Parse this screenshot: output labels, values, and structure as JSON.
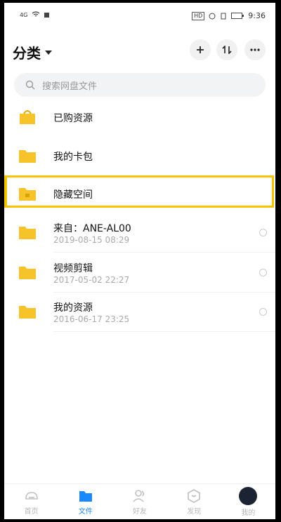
{
  "status_bar": {
    "signal": "4G",
    "hd_badge": "HD",
    "time": "9:36"
  },
  "header": {
    "title": "分类",
    "add_icon": "plus-icon",
    "sort_icon": "sort-icon",
    "more_icon": "more-icon"
  },
  "search": {
    "placeholder": "搜索网盘文件"
  },
  "folders": [
    {
      "name": "已购资源",
      "date": ""
    },
    {
      "name": "我的卡包",
      "date": ""
    },
    {
      "name": "隐藏空间",
      "date": ""
    },
    {
      "name": "来自：ANE-AL00",
      "date": "2019-08-15  08:29"
    },
    {
      "name": "视频剪辑",
      "date": "2017-05-02  22:27"
    },
    {
      "name": "我的资源",
      "date": "2016-06-17  23:25"
    }
  ],
  "tabs": [
    {
      "label": "首页",
      "icon": "home-icon"
    },
    {
      "label": "文件",
      "icon": "folder-icon"
    },
    {
      "label": "好友",
      "icon": "friends-icon"
    },
    {
      "label": "发现",
      "icon": "discover-icon"
    },
    {
      "label": "我的",
      "icon": "avatar"
    }
  ],
  "colors": {
    "folder": "#f6c32a",
    "accent": "#1a88ff",
    "highlight": "#f4c400"
  }
}
